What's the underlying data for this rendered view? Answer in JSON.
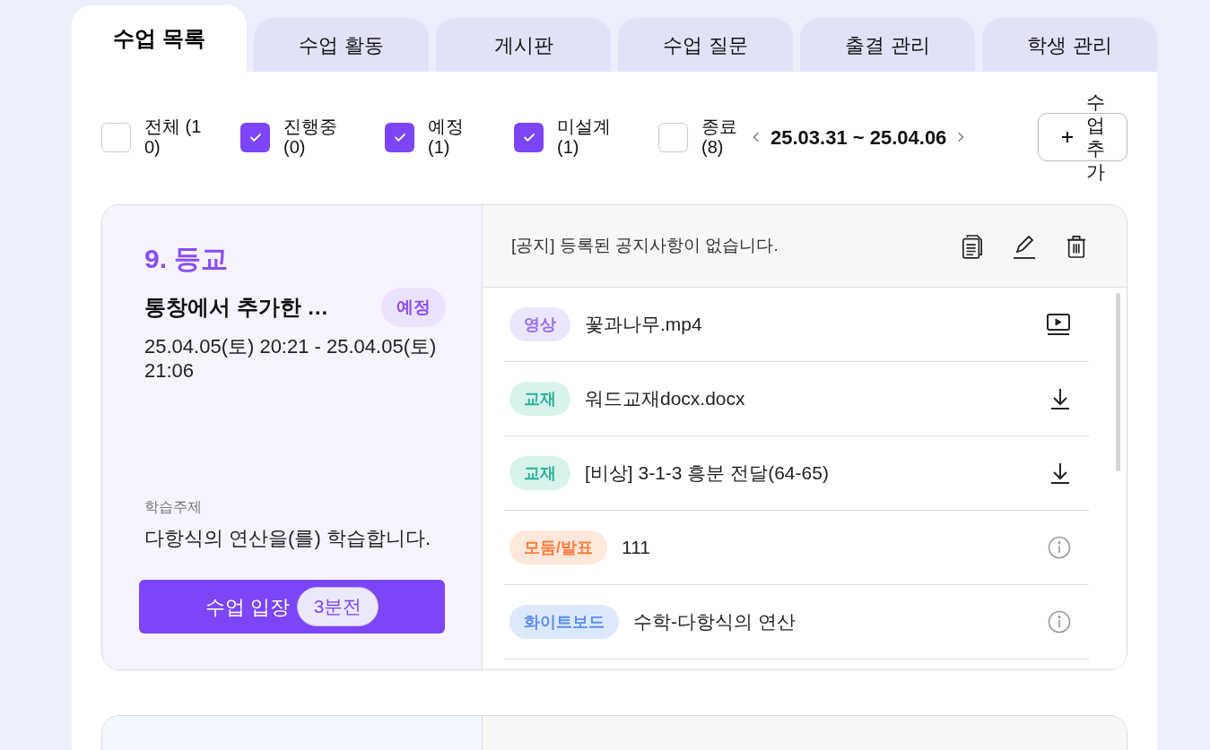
{
  "tabs": [
    {
      "label": "수업 목록",
      "selected": true
    },
    {
      "label": "수업 활동",
      "selected": false
    },
    {
      "label": "게시판",
      "selected": false
    },
    {
      "label": "수업 질문",
      "selected": false
    },
    {
      "label": "출결 관리",
      "selected": false
    },
    {
      "label": "학생 관리",
      "selected": false
    }
  ],
  "filters": [
    {
      "label": "전체 (10)",
      "checked": false
    },
    {
      "label": "진행중 (0)",
      "checked": true
    },
    {
      "label": "예정 (1)",
      "checked": true
    },
    {
      "label": "미설계 (1)",
      "checked": true
    },
    {
      "label": "종료 (8)",
      "checked": false
    }
  ],
  "date_range": "25.03.31 ~ 25.04.06",
  "add_button": "수업추가",
  "lessons": [
    {
      "color": "#f6f3fe",
      "title": "9. 등교",
      "name": "통창에서 추가한 …",
      "status": "예정",
      "time": "25.04.05(토) 20:21 - 25.04.05(토) 21:06",
      "topic_label": "학습주제",
      "topic": "다항식의 연산을(를) 학습합니다.",
      "enter_button": "수업 입장",
      "enter_badge": "3분전",
      "notice": "[공지] 등록된 공지사항이 없습니다.",
      "materials": [
        {
          "tag": "영상",
          "kind": "video",
          "name": "꽃과나무.mp4"
        },
        {
          "tag": "교재",
          "kind": "textbook",
          "name": "워드교재docx.docx"
        },
        {
          "tag": "교재",
          "kind": "textbook",
          "name": "[비상] 3-1-3 흥분 전달(64-65)"
        },
        {
          "tag": "모둠/발표",
          "kind": "group",
          "name": "111"
        },
        {
          "tag": "화이트보드",
          "kind": "whiteboard",
          "name": "수학-다항식의 연산"
        }
      ]
    },
    {
      "color": "#f3f7fe"
    }
  ]
}
